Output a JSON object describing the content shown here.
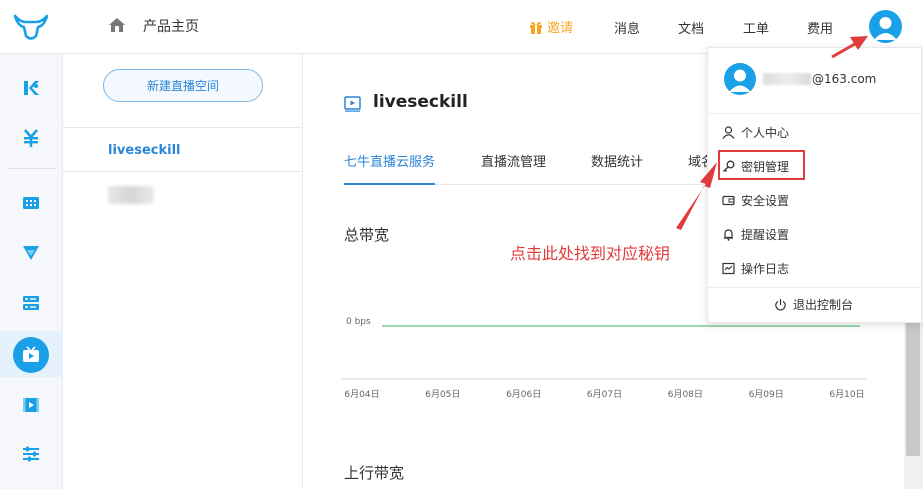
{
  "header": {
    "home_label": "产品主页",
    "nav": {
      "invite": "邀请",
      "messages": "消息",
      "docs": "文档",
      "tickets": "工单",
      "billing": "费用"
    },
    "colors": {
      "invite": "#f5a623",
      "accent": "#2b86d9"
    }
  },
  "rail": {
    "icons": [
      "k-icon",
      "yen-icon",
      "grid-icon",
      "funnel-icon",
      "server-icon",
      "live-tv-icon",
      "video-icon",
      "sliders-icon"
    ],
    "active": "live-tv-icon"
  },
  "list": {
    "new_button": "新建直播空间",
    "spaces": [
      "liveseckill"
    ]
  },
  "main": {
    "space_title": "liveseckill",
    "tabs": [
      "七牛直播云服务",
      "直播流管理",
      "数据统计",
      "域名"
    ],
    "active_tab": "七牛直播云服务",
    "bandwidth_title": "总带宽",
    "upstream_title": "上行带宽",
    "annotation": "点击此处找到对应秘钥"
  },
  "chart_data": {
    "type": "line",
    "x": [
      "6月04日",
      "6月05日",
      "6月06日",
      "6月07日",
      "6月08日",
      "6月09日",
      "6月10日"
    ],
    "series": [
      {
        "values": [
          0,
          0,
          0,
          0,
          0,
          0,
          0
        ]
      }
    ],
    "y_tick_labels": [
      "0 bps"
    ],
    "line_color": "#3bb06a"
  },
  "dropdown": {
    "email_suffix": "@163.com",
    "items": [
      "个人中心",
      "密钥管理",
      "安全设置",
      "提醒设置",
      "操作日志"
    ],
    "highlighted": "密钥管理",
    "logout": "退出控制台"
  }
}
